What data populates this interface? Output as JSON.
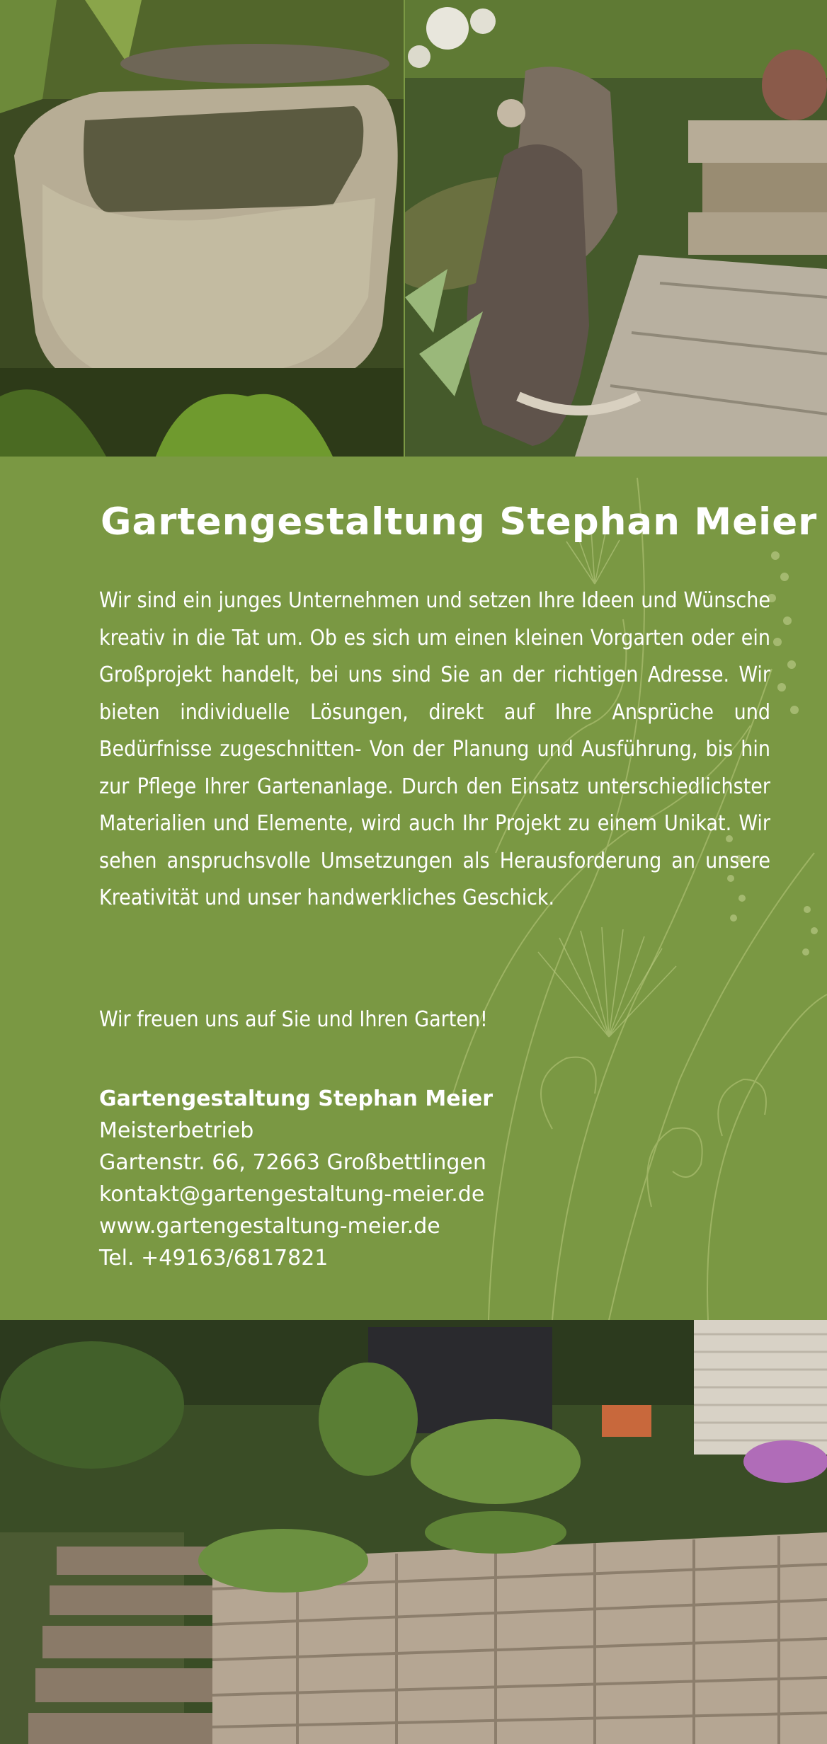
{
  "title": "Gartengestaltung Stephan Meier",
  "intro": "Wir sind ein junges Unternehmen und setzen Ihre Ideen und Wünsche kreativ in die Tat um. Ob es sich um einen kleinen Vorgarten oder ein Großprojekt handelt, bei uns sind Sie an der richtigen Adresse. Wir bieten individuelle Lösungen, direkt auf Ihre Ansprüche und Bedürfnisse zugeschnitten- Von der Planung und Ausführung, bis hin zur Pflege Ihrer Gartenanlage. Durch den Einsatz unterschiedlichster Materialien und Elemente, wird auch Ihr Projekt zu einem Unikat. Wir sehen anspruchsvolle Umsetzungen als Herausforderung an unsere Kreativität und unser handwerkliches Geschick.",
  "closing": "Wir freuen uns auf Sie und Ihren Garten!",
  "contact": {
    "name": "Gartengestaltung Stephan Meier",
    "subtitle": "Meisterbetrieb",
    "address": "Gartenstr. 66, 72663 Großbettlingen",
    "email": "kontakt@gartengestaltung-meier.de",
    "web": "www.gartengestaltung-meier.de",
    "phone": "Tel. +49163/6817821"
  },
  "colors": {
    "panel_green": "#7a9843",
    "text": "#ffffff"
  }
}
